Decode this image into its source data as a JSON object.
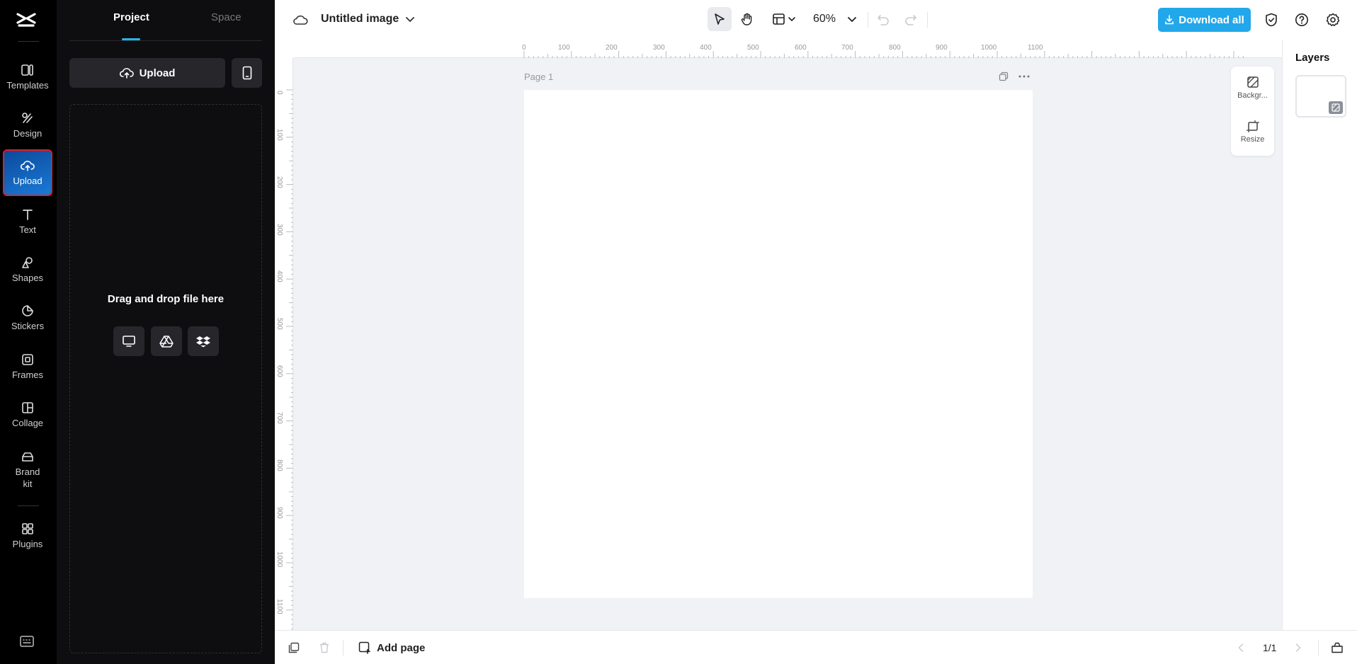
{
  "rail": {
    "items": [
      {
        "label": "Templates"
      },
      {
        "label": "Design"
      },
      {
        "label": "Upload"
      },
      {
        "label": "Text"
      },
      {
        "label": "Shapes"
      },
      {
        "label": "Stickers"
      },
      {
        "label": "Frames"
      },
      {
        "label": "Collage"
      },
      {
        "label": "Brand\nkit"
      },
      {
        "label": "Plugins"
      }
    ],
    "active": "Upload",
    "active_color": "#1a7ad6"
  },
  "panel": {
    "tabs": [
      "Project",
      "Space"
    ],
    "active_tab": "Project",
    "upload_label": "Upload",
    "drop_text": "Drag and drop file here",
    "sources": [
      "computer-icon",
      "google-drive-icon",
      "dropbox-icon"
    ]
  },
  "topbar": {
    "doc_title": "Untitled image",
    "zoom": "60%",
    "download_label": "Download all",
    "accent": "#22a8ea"
  },
  "canvas": {
    "page_label": "Page 1",
    "ruler_top": [
      "0",
      "100",
      "200",
      "300",
      "400",
      "500",
      "600",
      "700",
      "800",
      "900",
      "1000",
      "1100"
    ],
    "ruler_left": [
      "0",
      "100",
      "200",
      "300",
      "400",
      "500",
      "600",
      "700",
      "800",
      "900",
      "1000",
      "1100"
    ],
    "side_tools": [
      "Backgr...",
      "Resize"
    ]
  },
  "layers": {
    "title": "Layers"
  },
  "bottombar": {
    "add_page": "Add page",
    "page_count": "1/1"
  }
}
